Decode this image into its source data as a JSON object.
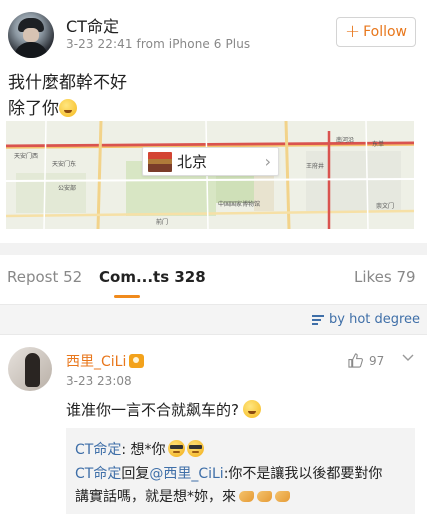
{
  "post": {
    "author": "CT命定",
    "meta": "3-23 22:41  from iPhone 6 Plus",
    "follow_label": "Follow",
    "follow_plus": "+",
    "text_line1": "我什麼都幹不好",
    "text_line2": "除了你",
    "emoji_name": "smile-emoji-icon"
  },
  "map": {
    "location_name": "北京",
    "chevron": "›",
    "labels": [
      "天安门东",
      "天安门西",
      "公安部",
      "王府井",
      "东单",
      "前门",
      "中国国家博物馆",
      "西单",
      "南河沿",
      "崇文门"
    ]
  },
  "tabs": {
    "repost": "Repost 52",
    "comments": "Com...ts 328",
    "likes": "Likes 79"
  },
  "sort_label": "by hot degree",
  "comment": {
    "author": "西里_CiLi",
    "time": "3-23 23:08",
    "likes": "97",
    "text": "谁准你一言不合就飙车的?",
    "replies": [
      {
        "user": "CT命定",
        "sep": ": 想*你"
      },
      {
        "user": "CT命定",
        "mid": "回复",
        "mention": "@西里_CiLi",
        "text": ":你不是讓我以後都要對你"
      },
      {
        "text": "講實話嗎，就是想*妳，來"
      }
    ]
  },
  "colors": {
    "accent_orange": "#e8771c",
    "link_blue": "#3f6fa8",
    "tab_underline": "#f08a1c"
  }
}
